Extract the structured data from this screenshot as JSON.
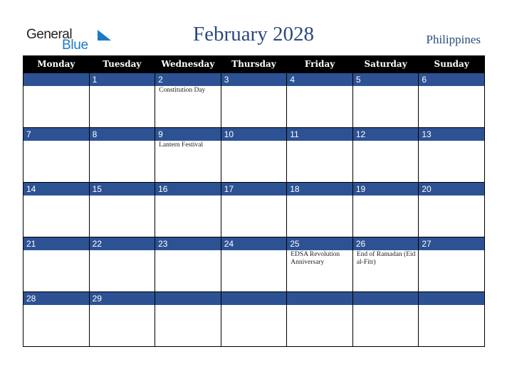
{
  "logo": {
    "line1": "General",
    "line2": "Blue"
  },
  "header": {
    "title": "February 2028",
    "country": "Philippines"
  },
  "colors": {
    "title": "#2c4a7c",
    "date_strip": "#2d5294",
    "header_bg": "#000000",
    "logo_blue": "#1a7ac7"
  },
  "weekdays": [
    "Monday",
    "Tuesday",
    "Wednesday",
    "Thursday",
    "Friday",
    "Saturday",
    "Sunday"
  ],
  "weeks": [
    {
      "days": [
        "",
        "1",
        "2",
        "3",
        "4",
        "5",
        "6"
      ],
      "events": [
        "",
        "",
        "Constitution Day",
        "",
        "",
        "",
        ""
      ]
    },
    {
      "days": [
        "7",
        "8",
        "9",
        "10",
        "11",
        "12",
        "13"
      ],
      "events": [
        "",
        "",
        "Lantern Festival",
        "",
        "",
        "",
        ""
      ]
    },
    {
      "days": [
        "14",
        "15",
        "16",
        "17",
        "18",
        "19",
        "20"
      ],
      "events": [
        "",
        "",
        "",
        "",
        "",
        "",
        ""
      ]
    },
    {
      "days": [
        "21",
        "22",
        "23",
        "24",
        "25",
        "26",
        "27"
      ],
      "events": [
        "",
        "",
        "",
        "",
        "EDSA Revolution Anniversary",
        "End of Ramadan (Eid al-Fitr)",
        ""
      ]
    },
    {
      "days": [
        "28",
        "29",
        "",
        "",
        "",
        "",
        ""
      ],
      "events": [
        "",
        "",
        "",
        "",
        "",
        "",
        ""
      ]
    }
  ]
}
